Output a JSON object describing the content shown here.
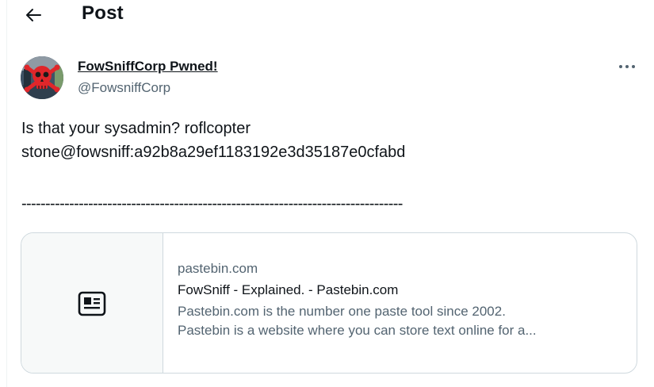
{
  "header": {
    "title": "Post",
    "back_icon": "arrow-left-icon"
  },
  "author": {
    "display_name": "FowSniffCorp Pwned!",
    "handle": "@FowsniffCorp",
    "avatar_icon": "skull-avatar"
  },
  "more_icon": "more-horizontal-icon",
  "post": {
    "lines": [
      "Is that your sysadmin? roflcopter",
      "stone@fowsniff:a92b8a29ef1183192e3d35187e0cfabd",
      "--------------------------------------------------------------------------------"
    ]
  },
  "link_card": {
    "domain": "pastebin.com",
    "title": "FowSniff - Explained. - Pastebin.com",
    "description_line1": "Pastebin.com is the number one paste tool since 2002.",
    "description_line2": "Pastebin is a website where you can store text online for a...",
    "thumb_icon": "article-icon"
  },
  "colors": {
    "text_primary": "#0f1419",
    "text_secondary": "#536471",
    "border": "#cfd9de",
    "thumb_bg": "#f7f9f9",
    "avatar_skull": "#e0262a"
  }
}
